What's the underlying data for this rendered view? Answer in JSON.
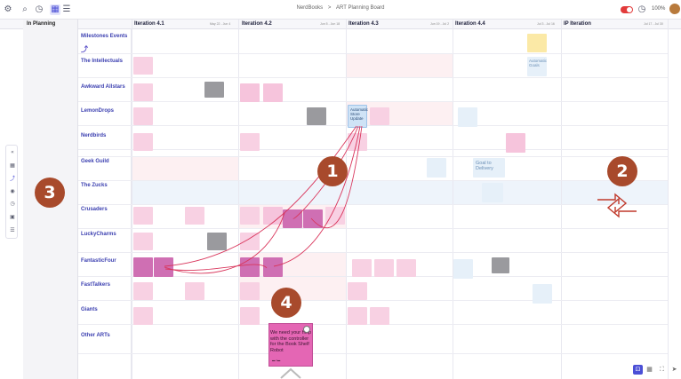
{
  "topbar": {
    "breadcrumb": [
      "NerdBooks",
      ">",
      "ART Planning Board"
    ],
    "zoom": "100%",
    "icons": [
      "settings-icon",
      "search-icon",
      "history-icon",
      "board-view-icon",
      "list-view-icon"
    ]
  },
  "planning_column": {
    "title": "In Planning"
  },
  "iterations": [
    {
      "name": "Iteration 4.1",
      "dates": "May 22 - Jun 4"
    },
    {
      "name": "Iteration 4.2",
      "dates": "Jun 5 - Jun 18"
    },
    {
      "name": "Iteration 4.3",
      "dates": "Jun 19 - Jul 2"
    },
    {
      "name": "Iteration 4.4",
      "dates": "Jul 3 - Jul 16"
    },
    {
      "name": "IP Iteration",
      "dates": "Jul 17 - Jul 30"
    }
  ],
  "teams": [
    "Milestones Events",
    "The Intellectuals",
    "Awkward Allstars",
    "LemonDrops",
    "Nerdbirds",
    "Geek Guild",
    "The Zucks",
    "Crusaders",
    "LuckyCharms",
    "FantasticFour",
    "FastTalkers",
    "Giants",
    "Other ARTs"
  ],
  "cards_text": {
    "lemondrops_blue": "Automatic Store Update",
    "geekguild_goal": "Goal to Delivery",
    "intellectuals_note": "Automatic Goals"
  },
  "sticky_note": {
    "text": "We need your help with the controller for the Book Shelf Robot"
  },
  "badges": [
    "1",
    "2",
    "3",
    "4"
  ],
  "colors": {
    "accent": "#4b4fd6",
    "badge": "#a84a2c",
    "sticky": "#e466b4",
    "dependency_line": "#d9365c"
  }
}
